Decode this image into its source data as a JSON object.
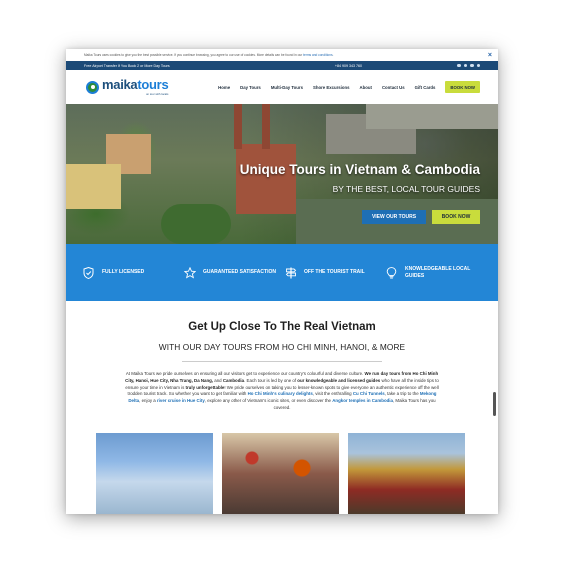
{
  "cookie": {
    "text": "Maika Tours uses cookies to give you the best possible service. If you continue browsing, you agree to our use of cookies. More details can be found in our ",
    "link": "terms and conditions",
    "end": "."
  },
  "topbar": {
    "promo": "Free Airport Transfer If You Book 2 or More Day Tours",
    "phone": "+84 909 343 760"
  },
  "logo": {
    "text_a": "maika",
    "text_b": "tours",
    "tagline": "on tour with locals"
  },
  "nav": {
    "items": [
      "Home",
      "Day Tours",
      "Multi-Day Tours",
      "Shore Excursions",
      "About",
      "Contact Us",
      "Gift Cards"
    ],
    "book": "BOOK NOW"
  },
  "hero": {
    "title": "Unique Tours in Vietnam & Cambodia",
    "subtitle": "BY THE BEST, LOCAL TOUR GUIDES",
    "view_btn": "VIEW OUR TOURS",
    "book_btn": "BOOK NOW"
  },
  "features": [
    {
      "label": "FULLY LICENSED",
      "icon": "shield-icon"
    },
    {
      "label": "GUARANTEED SATISFACTION",
      "icon": "star-icon"
    },
    {
      "label": "OFF THE TOURIST TRAIL",
      "icon": "signpost-icon"
    },
    {
      "label": "KNOWLEDGEABLE LOCAL GUIDES",
      "icon": "bulb-icon"
    }
  ],
  "intro": {
    "heading": "Get Up Close To The Real Vietnam",
    "subheading": "WITH OUR DAY TOURS FROM HO CHI MINH, HANOI, & MORE",
    "p1": "At Maika Tours we pride ourselves on ensuring all our visitors get to experience our country's colourful and diverse culture. ",
    "p1b": "We run day tours from Ho Chi Minh City, Hanoi, Hue City, Nha Trang, Da Nang,",
    "p1c": " and ",
    "p1d": "Cambodia",
    "p2": ". Each tour is led by one of ",
    "p2b": "our knowledgeable and licensed guides",
    "p3": " who have all the inside tips to ensure your time in Vietnam is ",
    "p3b": "truly unforgettable",
    "p4": "! We pride ourselves on taking you to lesser-known spots to give everyone an authentic experience off the well trodden tourist track. So whether you want to get familiar with ",
    "l1": "Ho Chi Minh's culinary delights",
    "p5": ", visit the enthralling ",
    "l2": "Cu Chi Tunnels",
    "p6": ", take a trip to the ",
    "l3": "Mekong Delta",
    "p7": ", enjoy a ",
    "l4": "river cruise in Hue City",
    "p8": ", explore any other of Vietnam's iconic sites, or even discover the ",
    "l5": "Angkor temples in Cambodia",
    "p9": ", Maika Tours has you covered."
  }
}
